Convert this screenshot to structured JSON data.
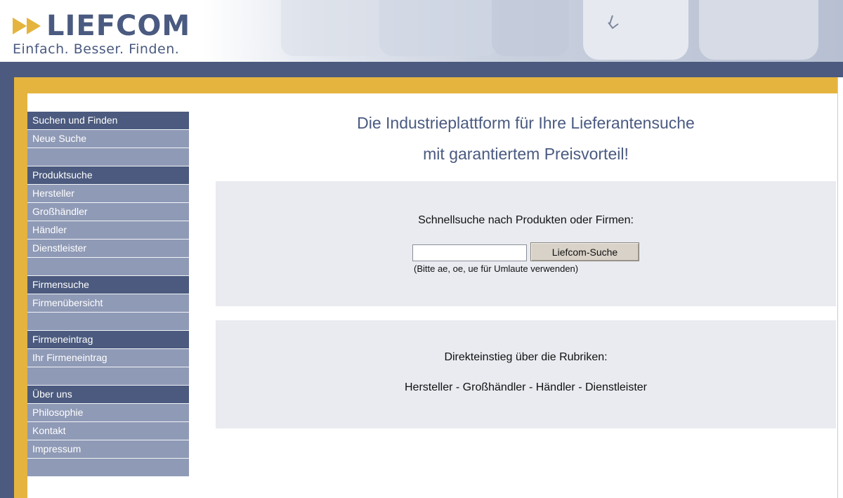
{
  "header": {
    "logo_text": "LIEFCOM",
    "tagline": "Einfach. Besser. Finden.",
    "colors": {
      "brand_blue": "#4b5a7e",
      "brand_yellow": "#e5b43e",
      "nav_item": "#8f9ab6"
    }
  },
  "sidebar": {
    "groups": [
      {
        "heading": "Suchen und Finden",
        "items": [
          "Neue Suche"
        ]
      },
      {
        "heading": "Produktsuche",
        "items": [
          "Hersteller",
          "Großhändler",
          "Händler",
          "Dienstleister"
        ]
      },
      {
        "heading": "Firmensuche",
        "items": [
          "Firmenübersicht"
        ]
      },
      {
        "heading": "Firmeneintrag",
        "items": [
          "Ihr Firmeneintrag"
        ]
      },
      {
        "heading": "Über uns",
        "items": [
          "Philosophie",
          "Kontakt",
          "Impressum"
        ]
      }
    ]
  },
  "main": {
    "headline_line1": "Die Industrieplattform für Ihre Lieferantensuche",
    "headline_line2": "mit garantiertem Preisvorteil!",
    "search": {
      "label": "Schnellsuche nach Produkten oder Firmen:",
      "input_value": "",
      "button_label": "Liefcom-Suche",
      "hint": "(Bitte ae, oe, ue für Umlaute verwenden)"
    },
    "direct": {
      "label": "Direkteinstieg über die Rubriken:",
      "rubrics": [
        "Hersteller",
        "Großhändler",
        "Händler",
        "Dienstleister"
      ],
      "separator": " - "
    }
  }
}
